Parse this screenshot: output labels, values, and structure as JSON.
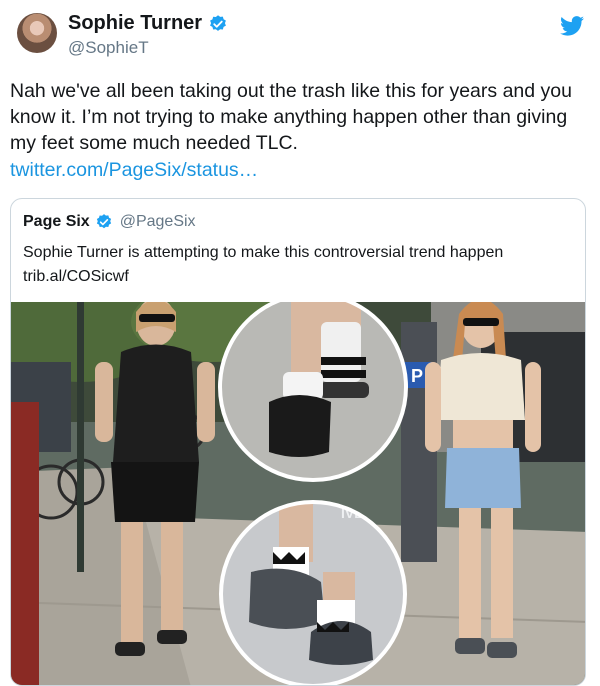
{
  "tweet": {
    "display_name": "Sophie Turner",
    "handle": "@SophieT",
    "text": "Nah we've all been taking out the trash like this for years and you know it. I’m not trying to make anything happen other than giving my feet some much needed TLC.",
    "link": "twitter.com/PageSix/status…",
    "avatar_icon": "profile-photo",
    "verified_icon": "verified-badge-icon",
    "platform_icon": "twitter-bird-icon"
  },
  "quote": {
    "display_name": "Page Six",
    "handle": "@PageSix",
    "text_line1": "Sophie Turner is attempting to make this controversial trend happen",
    "text_line2": "trib.al/COSicwf",
    "parking_sign": "P",
    "street_stencil": "IVE"
  },
  "colors": {
    "link": "#1b95e0",
    "verified": "#1da1f2",
    "secondary_text": "#657786",
    "border": "#ccd6dd"
  }
}
